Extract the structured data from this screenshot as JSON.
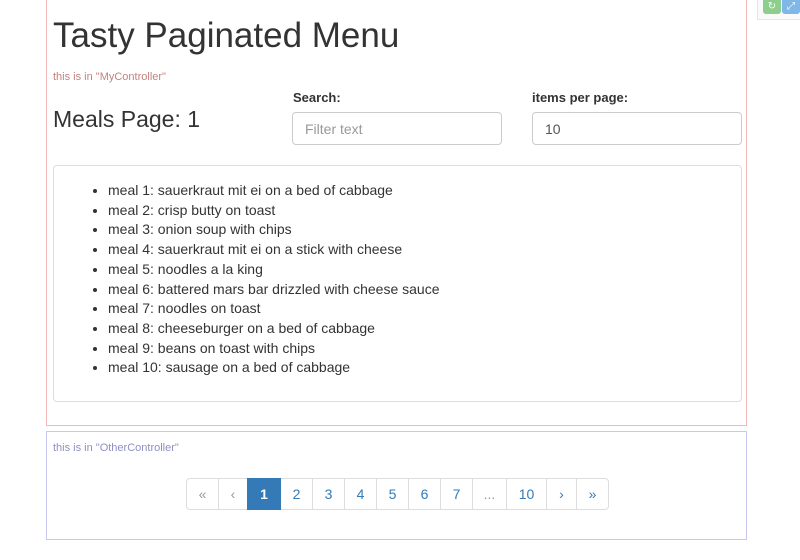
{
  "my_controller": {
    "title": "Tasty Paginated Menu",
    "note": "this is in \"MyController\"",
    "meals_heading": "Meals Page: 1",
    "search": {
      "label": "Search:",
      "placeholder": "Filter text",
      "value": ""
    },
    "items_per_page": {
      "label": "items per page:",
      "value": "10"
    },
    "meals": [
      "meal 1: sauerkraut mit ei on a bed of cabbage",
      "meal 2: crisp butty on toast",
      "meal 3: onion soup with chips",
      "meal 4: sauerkraut mit ei on a stick with cheese",
      "meal 5: noodles a la king",
      "meal 6: battered mars bar drizzled with cheese sauce",
      "meal 7: noodles on toast",
      "meal 8: cheeseburger on a bed of cabbage",
      "meal 9: beans on toast with chips",
      "meal 10: sausage on a bed of cabbage"
    ]
  },
  "other_controller": {
    "note": "this is in \"OtherController\"",
    "pagination": {
      "first": "«",
      "prev": "‹",
      "pages": [
        "1",
        "2",
        "3",
        "4",
        "5",
        "6",
        "7"
      ],
      "ellipsis": "...",
      "last_page": "10",
      "next": "›",
      "last": "»",
      "current_page": "1"
    }
  },
  "corner_widget": {
    "refresh_icon": "refresh-icon",
    "expand_icon": "expand-icon"
  },
  "colors": {
    "link": "#337ab7",
    "active_page_bg": "#337ab7",
    "my_controller_border": "#f3b8b8",
    "other_controller_border": "#c8c8f0"
  }
}
